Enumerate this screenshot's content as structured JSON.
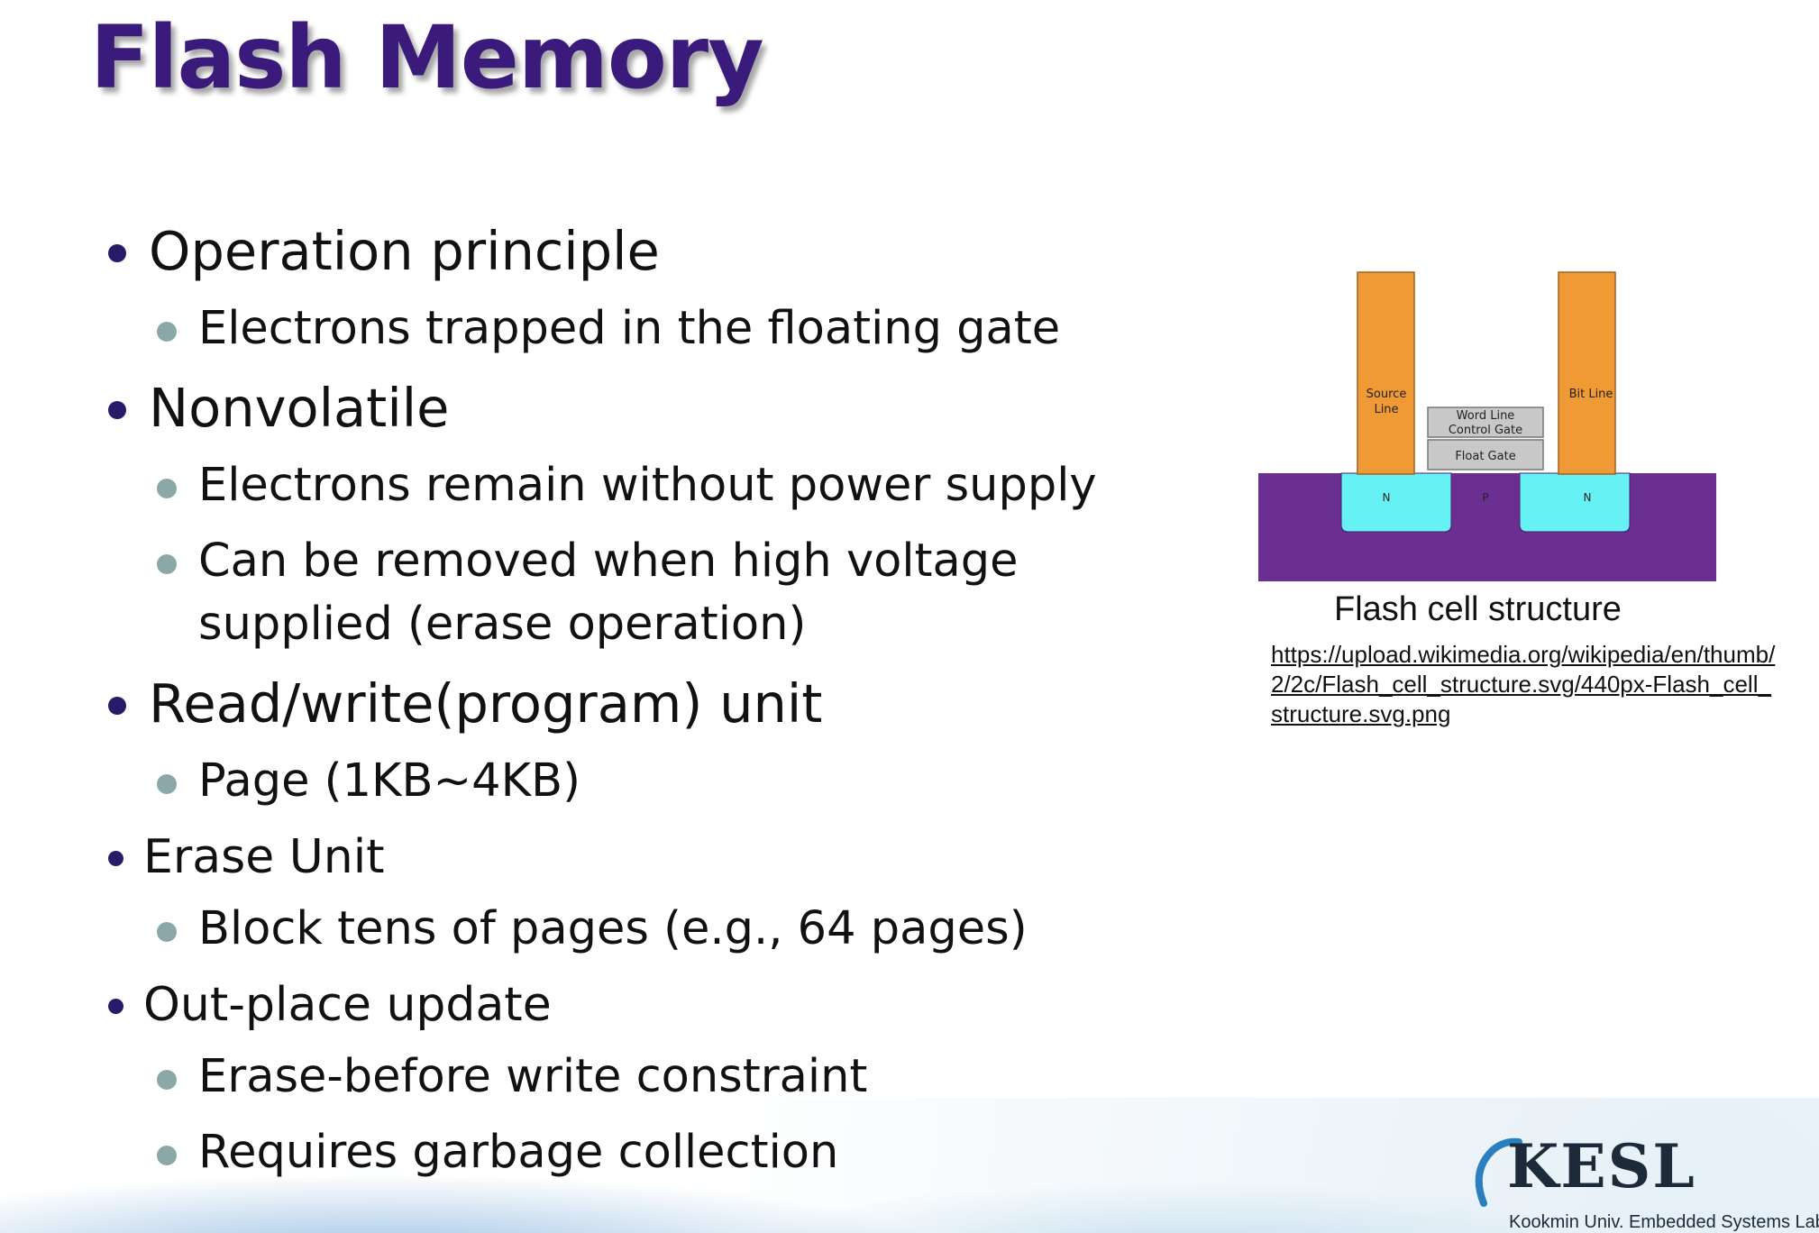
{
  "slide": {
    "title": "Flash Memory",
    "bullets": [
      {
        "label": "Operation principle",
        "sub": [
          "Electrons trapped in the floating gate"
        ]
      },
      {
        "label": "Nonvolatile",
        "sub": [
          "Electrons remain without power supply",
          "Can be removed when high voltage supplied (erase operation)"
        ]
      },
      {
        "label": "Read/write(program) unit",
        "sub": [
          "Page (1KB~4KB)"
        ]
      },
      {
        "label": "Erase Unit",
        "sub": [
          "Block tens of pages (e.g., 64 pages)"
        ]
      },
      {
        "label": "Out-place update",
        "sub": [
          "Erase-before write constraint",
          "Requires garbage collection"
        ]
      }
    ]
  },
  "figure": {
    "labels": {
      "source_line_1": "Source",
      "source_line_2": "Line",
      "bit_line": "Bit Line",
      "word_line": "Word Line",
      "control_gate": "Control Gate",
      "float_gate": "Float Gate",
      "n_left": "N",
      "p": "P",
      "n_right": "N"
    },
    "caption": "Flash cell structure",
    "url": "https://upload.wikimedia.org/wikipedia/en/thumb/2/2c/Flash_cell_structure.svg/440px-Flash_cell_structure.svg.png",
    "colors": {
      "line": "#f09a36",
      "substrate": "#6a2f91",
      "n_region": "#66f2f5",
      "gate": "#c8c8c8"
    }
  },
  "logo": {
    "name": "KESL",
    "subtitle": "Kookmin Univ. Embedded Systems Lab"
  }
}
